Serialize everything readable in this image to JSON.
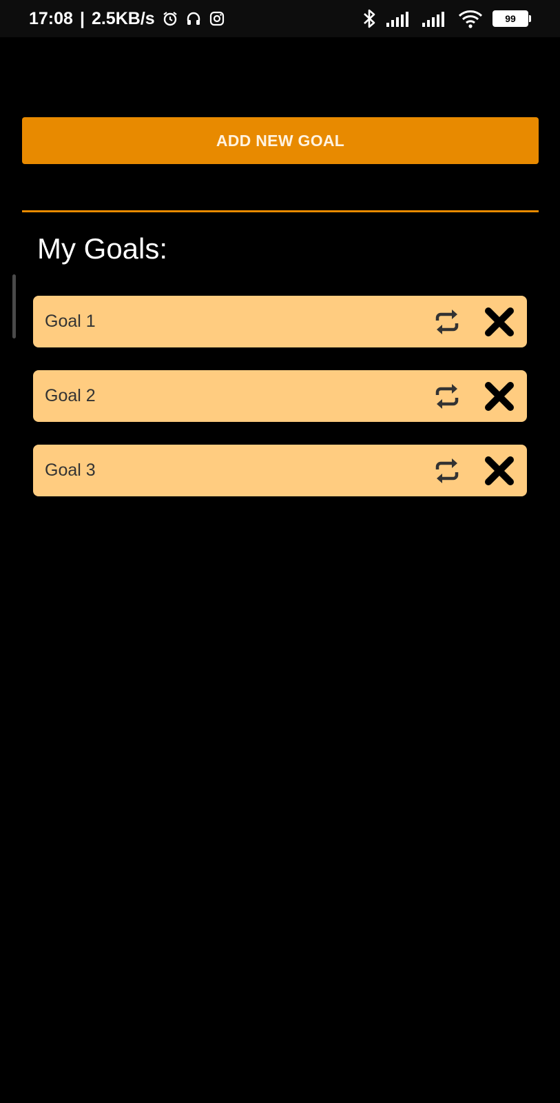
{
  "status_bar": {
    "time": "17:08",
    "speed": "2.5KB/s",
    "battery_level": "99",
    "icons": [
      "alarm-icon",
      "headphones-icon",
      "instagram-icon",
      "bluetooth-icon",
      "signal-icon",
      "signal-icon",
      "wifi-icon",
      "battery-icon"
    ]
  },
  "actions": {
    "add_goal_label": "ADD NEW GOAL"
  },
  "goals_section": {
    "title": "My Goals:",
    "items": [
      {
        "label": "Goal 1",
        "repeat_icon": "repeat-icon",
        "delete_icon": "close-icon"
      },
      {
        "label": "Goal 2",
        "repeat_icon": "repeat-icon",
        "delete_icon": "close-icon"
      },
      {
        "label": "Goal 3",
        "repeat_icon": "repeat-icon",
        "delete_icon": "close-icon"
      }
    ]
  },
  "colors": {
    "background": "#000000",
    "accent": "#E88A00",
    "card": "#FFCC80",
    "card_text": "#333333"
  }
}
